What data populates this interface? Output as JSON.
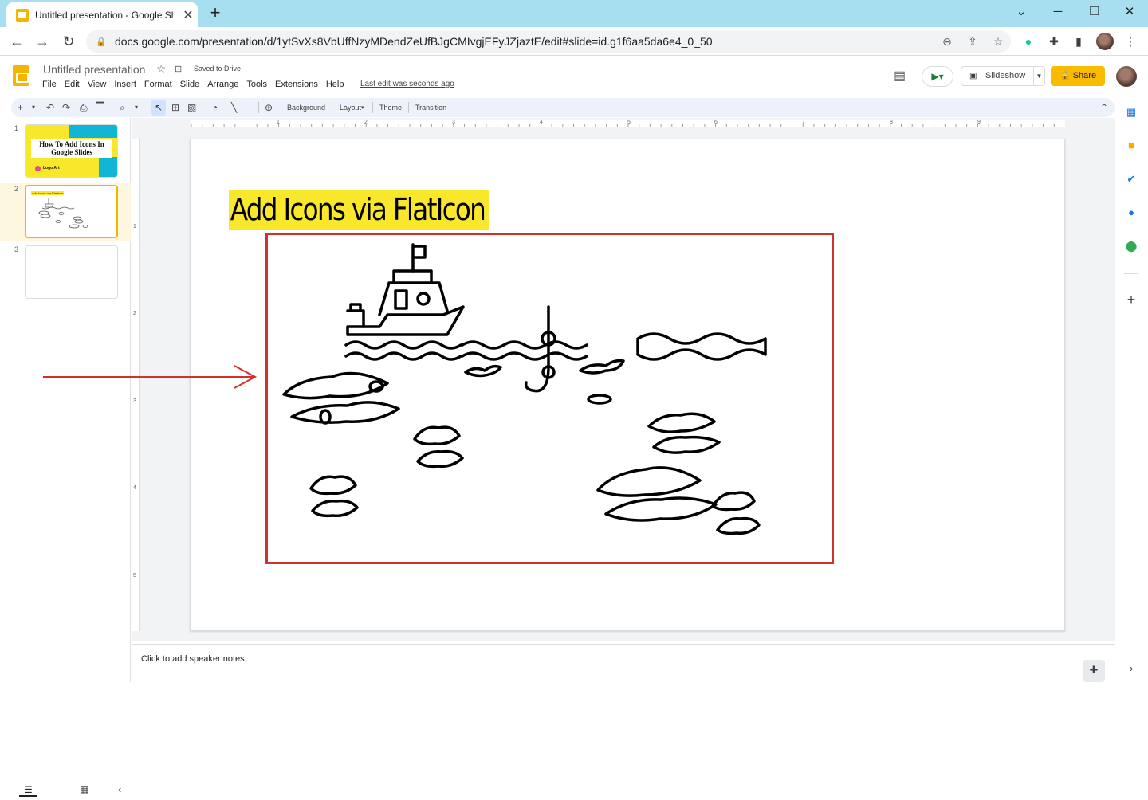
{
  "browser": {
    "tab_title": "Untitled presentation - Google Sl",
    "url": "docs.google.com/presentation/d/1ytSvXs8VbUffNzyMDendZeUfBJgCMIvgjEFyJZjaztE/edit#slide=id.g1f6aa5da6e4_0_50"
  },
  "app": {
    "doc_title": "Untitled presentation",
    "save_status": "Saved to Drive",
    "menu": [
      "File",
      "Edit",
      "View",
      "Insert",
      "Format",
      "Slide",
      "Arrange",
      "Tools",
      "Extensions",
      "Help"
    ],
    "last_edit": "Last edit was seconds ago",
    "slideshow_label": "Slideshow",
    "share_label": "Share"
  },
  "toolbar": {
    "background": "Background",
    "layout": "Layout",
    "theme": "Theme",
    "transition": "Transition"
  },
  "filmstrip": {
    "slides": [
      {
        "num": "1",
        "title": "How To Add Icons In Google Slides",
        "brand": "Logo Art"
      },
      {
        "num": "2",
        "title": "Add Icons via FlatIcon"
      },
      {
        "num": "3"
      }
    ]
  },
  "ruler": {
    "h": [
      "1",
      "2",
      "3",
      "4",
      "5",
      "6",
      "7",
      "8",
      "9"
    ],
    "v": [
      "1",
      "2",
      "3",
      "4",
      "5"
    ]
  },
  "slide": {
    "title": "Add Icons via FlatIcon"
  },
  "notes": {
    "placeholder": "Click to add speaker notes"
  },
  "colors": {
    "accent_yellow": "#f9e72b",
    "share_yellow": "#f9bb00",
    "frame_red": "#d32f2f"
  }
}
